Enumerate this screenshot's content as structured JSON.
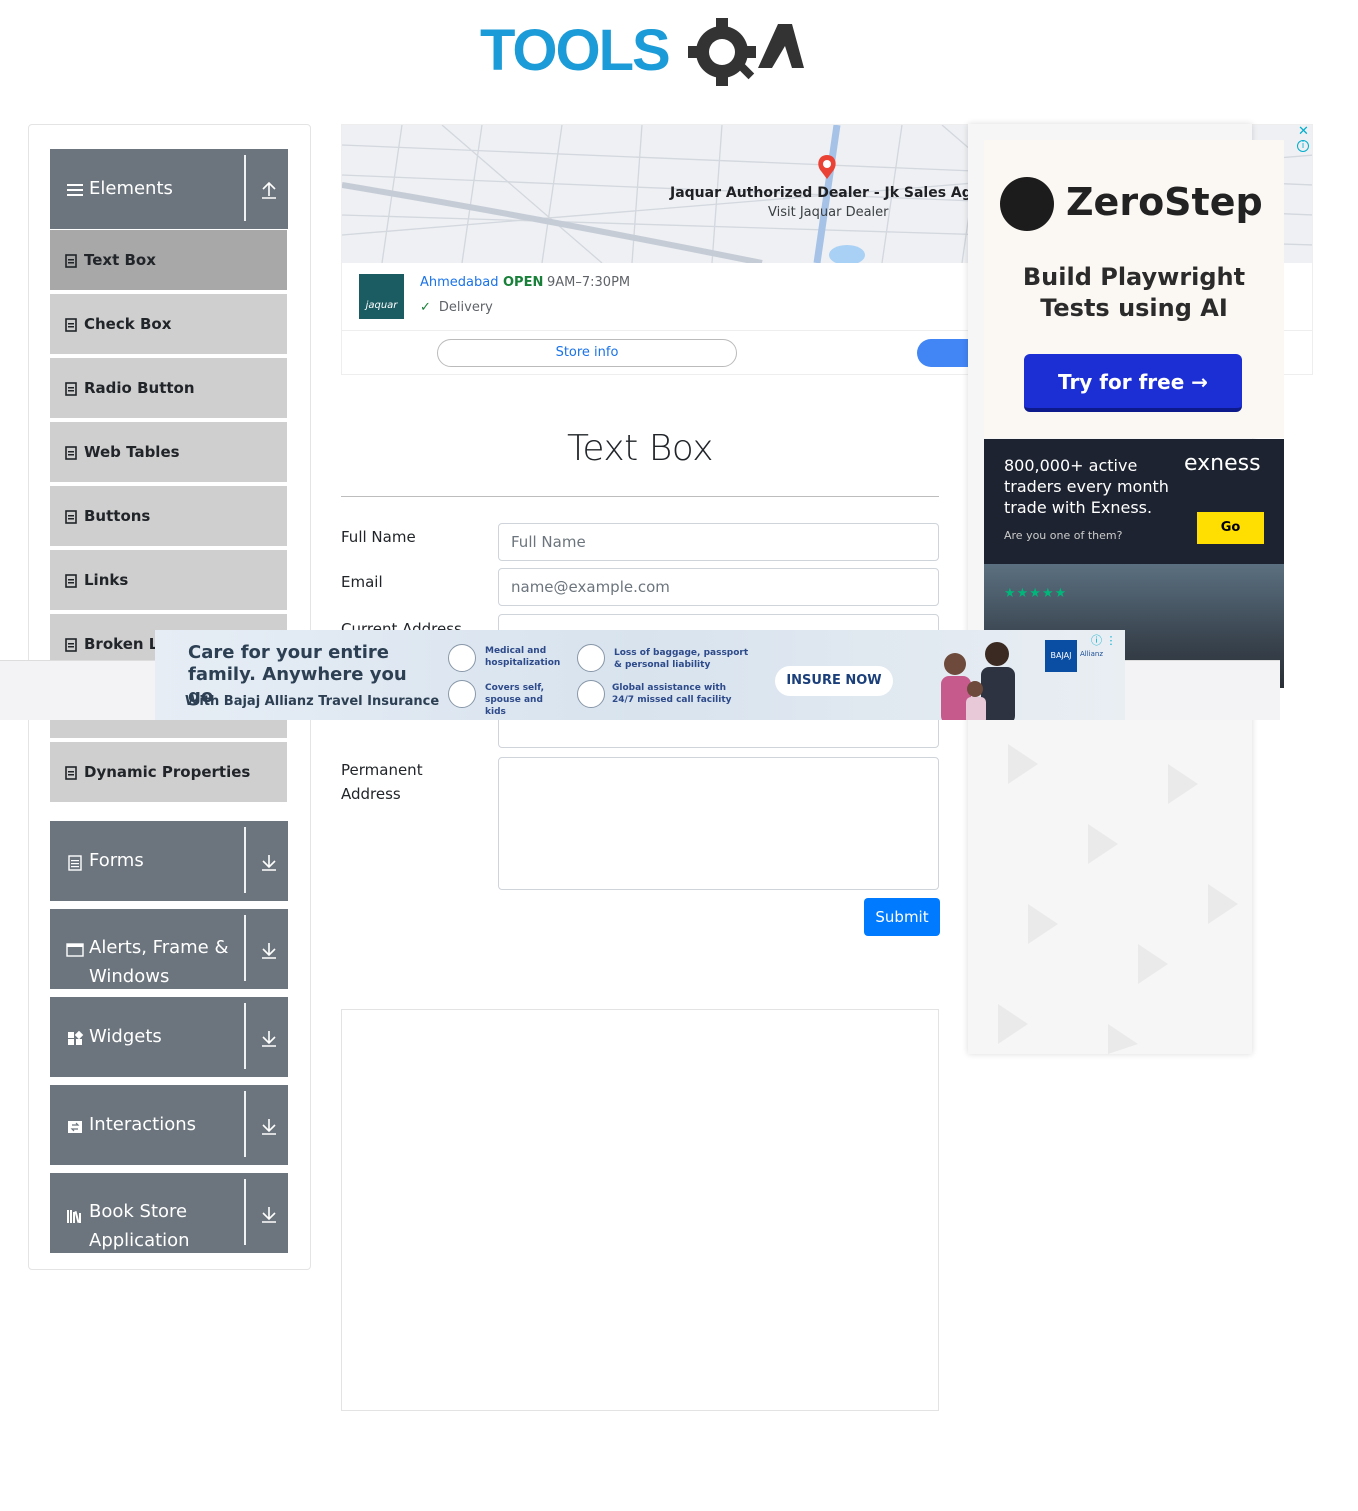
{
  "logo": {
    "text": "TOOLSQA"
  },
  "sidebar": {
    "groups": [
      {
        "label": "Elements",
        "icon": "hamburger-icon",
        "arrow": "arrow-up-icon"
      },
      {
        "label": "Forms",
        "icon": "document-icon",
        "arrow": "arrow-down-icon"
      },
      {
        "label": "Alerts, Frame & Windows",
        "icon": "window-icon",
        "arrow": "arrow-down-icon"
      },
      {
        "label": "Widgets",
        "icon": "widgets-icon",
        "arrow": "arrow-down-icon"
      },
      {
        "label": "Interactions",
        "icon": "interactions-icon",
        "arrow": "arrow-down-icon"
      },
      {
        "label": "Book Store Application",
        "icon": "books-icon",
        "arrow": "arrow-down-icon"
      }
    ],
    "element_items": [
      "Text Box",
      "Check Box",
      "Radio Button",
      "Web Tables",
      "Buttons",
      "Links",
      "Broken Li",
      "Dynamic Properties"
    ],
    "active_item": "Text Box"
  },
  "map_ad": {
    "pin_title": "Jaquar Authorized Dealer - Jk Sales Agen",
    "pin_sub": "Visit Jaquar Dealer",
    "logo_text": "jaquar",
    "city": "Ahmedabad",
    "status": "OPEN",
    "hours": "9AM–7:30PM",
    "delivery": "Delivery",
    "store_button": "Store info",
    "close_glyph": "✕",
    "info_glyph": "i"
  },
  "form": {
    "title": "Text Box",
    "full_name_label": "Full Name",
    "full_name_placeholder": "Full Name",
    "email_label": "Email",
    "email_placeholder": "name@example.com",
    "current_address_label": "Current Address",
    "permanent_address_label": "Permanent Address",
    "submit_label": "Submit"
  },
  "zerostep_ad": {
    "brand": "ZeroStep",
    "tagline": "Build Playwright Tests using AI",
    "button": "Try for free →"
  },
  "exness_ad": {
    "headline": "800,000+ active traders every month trade with Exness.",
    "brand": "exness",
    "question": "Are you one of them?",
    "button": "Go",
    "stars": "★★★★★"
  },
  "bajaj_ad": {
    "headline": "Care for your entire family. Anywhere you go",
    "subline": "With Bajaj Allianz Travel Insurance",
    "features": [
      "Medical and hospitalization",
      "Loss of baggage, passport & personal liability",
      "Covers self, spouse and kids",
      "Global assistance with 24/7 missed call facility"
    ],
    "button": "INSURE NOW",
    "logo_text": "BAJAJ",
    "partner": "Allianz",
    "info_glyph": "ⓘ ⋮"
  },
  "colors": {
    "logo_blue": "#1b9bd7",
    "logo_dark": "#333333",
    "sidebar_header": "#6c757d",
    "menu_item": "#cfcfcf",
    "menu_active": "#a8a8a8",
    "submit": "#007bff"
  }
}
